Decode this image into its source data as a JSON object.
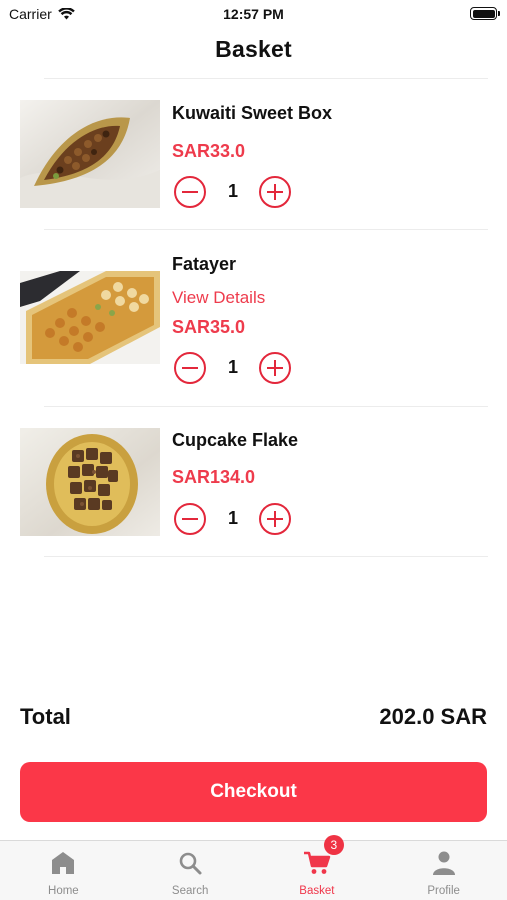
{
  "status_bar": {
    "carrier": "Carrier",
    "time": "12:57 PM"
  },
  "header": {
    "title": "Basket"
  },
  "items": [
    {
      "name": "Kuwaiti Sweet Box",
      "price": "SAR33.0",
      "qty": "1"
    },
    {
      "name": "Fatayer",
      "link": "View Details",
      "price": "SAR35.0",
      "qty": "1"
    },
    {
      "name": "Cupcake Flake",
      "price": "SAR134.0",
      "qty": "1"
    }
  ],
  "summary": {
    "total_label": "Total",
    "total_value": "202.0 SAR"
  },
  "checkout": {
    "label": "Checkout"
  },
  "tabs": [
    {
      "label": "Home",
      "icon": "home-icon"
    },
    {
      "label": "Search",
      "icon": "search-icon"
    },
    {
      "label": "Basket",
      "icon": "cart-icon",
      "badge": "3",
      "active": true
    },
    {
      "label": "Profile",
      "icon": "person-icon"
    }
  ],
  "colors": {
    "accent": "#fb3748",
    "price": "#ee3b4c",
    "inactive_tab": "#8d8d8d"
  }
}
